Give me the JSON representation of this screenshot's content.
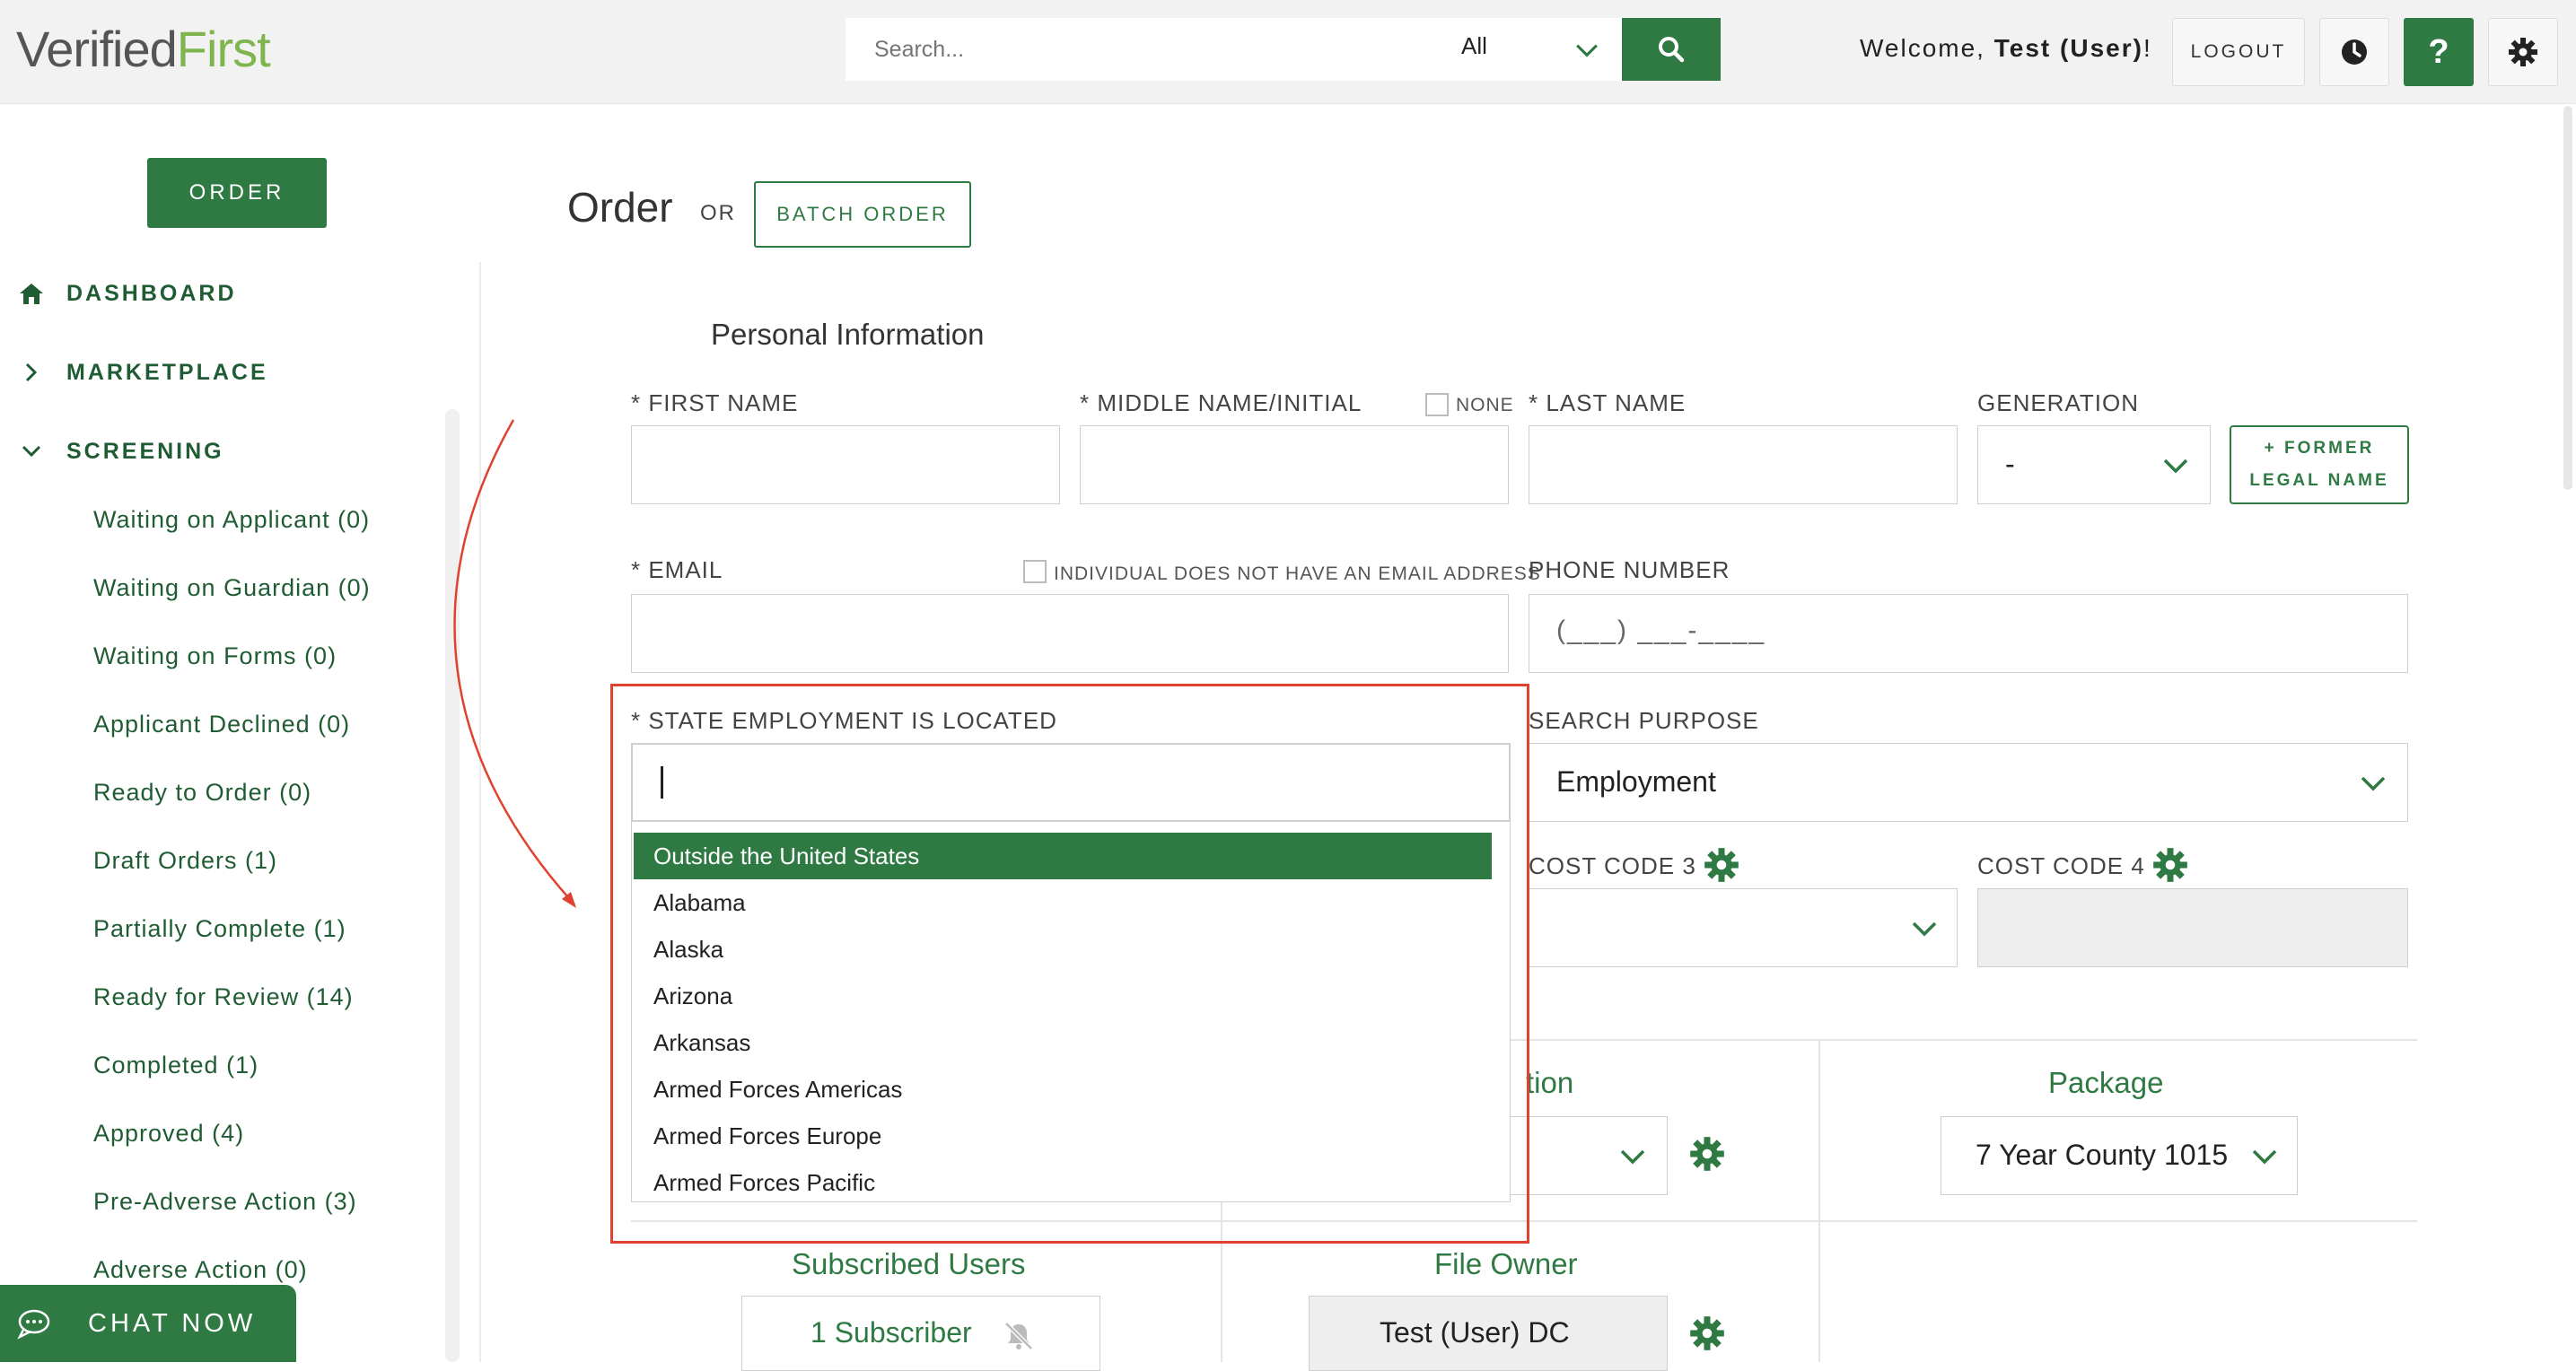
{
  "header": {
    "logo_verified": "Verified",
    "logo_first": "First",
    "search_placeholder": "Search...",
    "search_scope": "All",
    "welcome_prefix": "Welcome, ",
    "welcome_user": "Test (User)",
    "welcome_suffix": "!",
    "logout_label": "LOGOUT",
    "help_label": "?"
  },
  "sidebar": {
    "order_label": "ORDER",
    "dashboard_label": "DASHBOARD",
    "marketplace_label": "MARKETPLACE",
    "screening_label": "SCREENING",
    "items": [
      "Waiting on Applicant (0)",
      "Waiting on Guardian (0)",
      "Waiting on Forms (0)",
      "Applicant Declined (0)",
      "Ready to Order (0)",
      "Draft Orders (1)",
      "Partially Complete (1)",
      "Ready for Review (14)",
      "Completed (1)",
      "Approved (4)",
      "Pre-Adverse Action (3)",
      "Adverse Action (0)"
    ],
    "chat_label": "CHAT NOW"
  },
  "main": {
    "title": "Order",
    "or_label": "OR",
    "batch_order_label": "BATCH ORDER",
    "section_personal": "Personal Information",
    "first_name_label": "* FIRST NAME",
    "middle_name_label": "* MIDDLE NAME/INITIAL",
    "none_label": "NONE",
    "last_name_label": "* LAST NAME",
    "generation_label": "GENERATION",
    "generation_value": "-",
    "former_legal_line1": "+ FORMER",
    "former_legal_line2": "LEGAL NAME",
    "email_label": "* EMAIL",
    "no_email_label": "INDIVIDUAL DOES NOT HAVE AN EMAIL ADDRESS",
    "phone_label": "PHONE NUMBER",
    "phone_mask": "(___) ___-____",
    "state_label": "* STATE EMPLOYMENT IS LOCATED",
    "search_purpose_label": "SEARCH PURPOSE",
    "search_purpose_value": "Employment",
    "cost_code_3_label": "COST CODE 3",
    "cost_code_4_label": "COST CODE 4",
    "location_title_partial": "tion",
    "package_title": "Package",
    "package_value": "7 Year County 1015",
    "subscribed_users_title": "Subscribed Users",
    "subscriber_value": "1 Subscriber",
    "file_owner_title": "File Owner",
    "file_owner_value": "Test (User) DC"
  },
  "state_dropdown": {
    "options": [
      "Outside the United States",
      "Alabama",
      "Alaska",
      "Arizona",
      "Arkansas",
      "Armed Forces Americas",
      "Armed Forces Europe",
      "Armed Forces Pacific"
    ],
    "highlighted_index": 0
  },
  "colors": {
    "brand_green": "#2f7a43",
    "logo_green": "#7fb54e",
    "annotation_red": "#e0422e"
  },
  "icons": [
    "search-icon",
    "chevron-down-icon",
    "history-icon",
    "help-icon",
    "gear-icon",
    "home-icon",
    "chevron-right-icon",
    "chat-icon",
    "bell-off-icon"
  ]
}
